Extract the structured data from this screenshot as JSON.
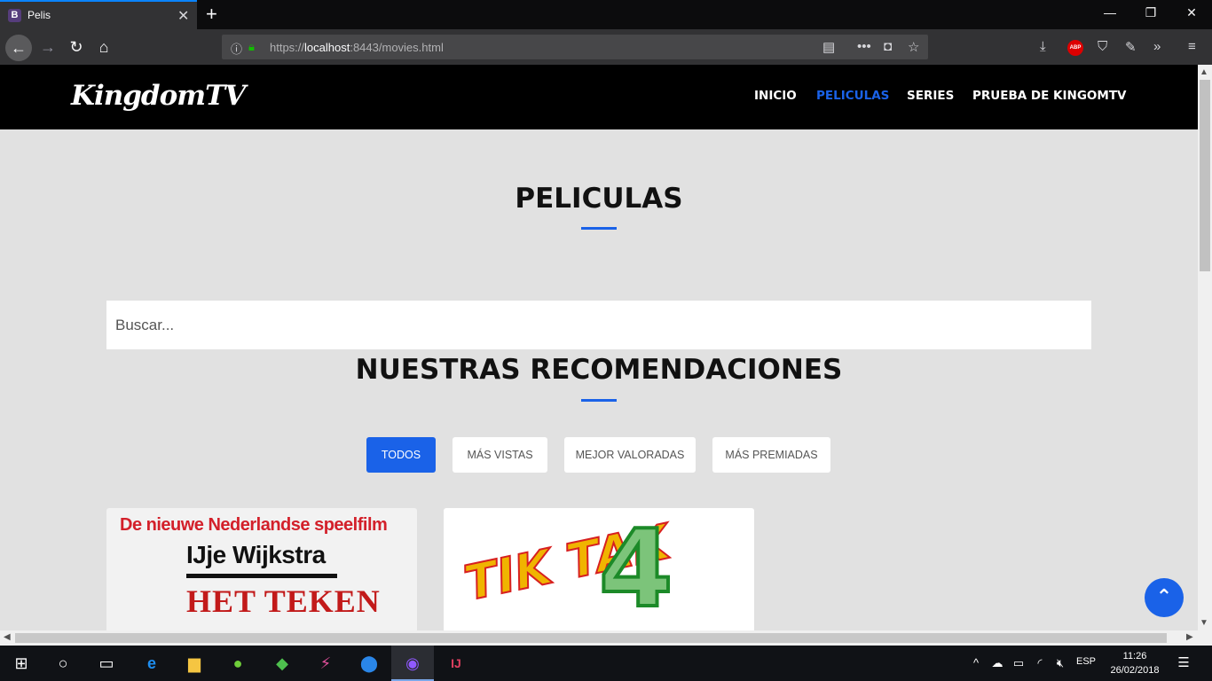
{
  "browser": {
    "tab_title": "Pelis",
    "tab_favicon": "B",
    "url_scheme": "https://",
    "url_host": "localhost",
    "url_rest": ":8443/movies.html"
  },
  "site": {
    "logo": "KingdomTV",
    "menu": [
      "INICIO",
      "PELICULAS",
      "SERIES",
      "PRUEBA DE KINGOMTV"
    ],
    "active_menu": "PELICULAS",
    "accent": "#1a62e8",
    "page_title": "PELICULAS",
    "search_placeholder": "Buscar...",
    "section_title": "NUESTRAS RECOMENDACIONES",
    "filters": [
      "TODOS",
      "MÁS VISTAS",
      "MEJOR VALORADAS",
      "MÁS PREMIADAS"
    ],
    "active_filter": "TODOS",
    "card1": {
      "line1": "De nieuwe Nederlandse speelfilm",
      "line2": "IJje Wijkstra",
      "line3": "HET TEKEN"
    },
    "card2": {
      "text": "TIK TAK",
      "number": "4"
    }
  },
  "taskbar": {
    "lang": "ESP",
    "time": "11:26",
    "date": "26/02/2018"
  }
}
